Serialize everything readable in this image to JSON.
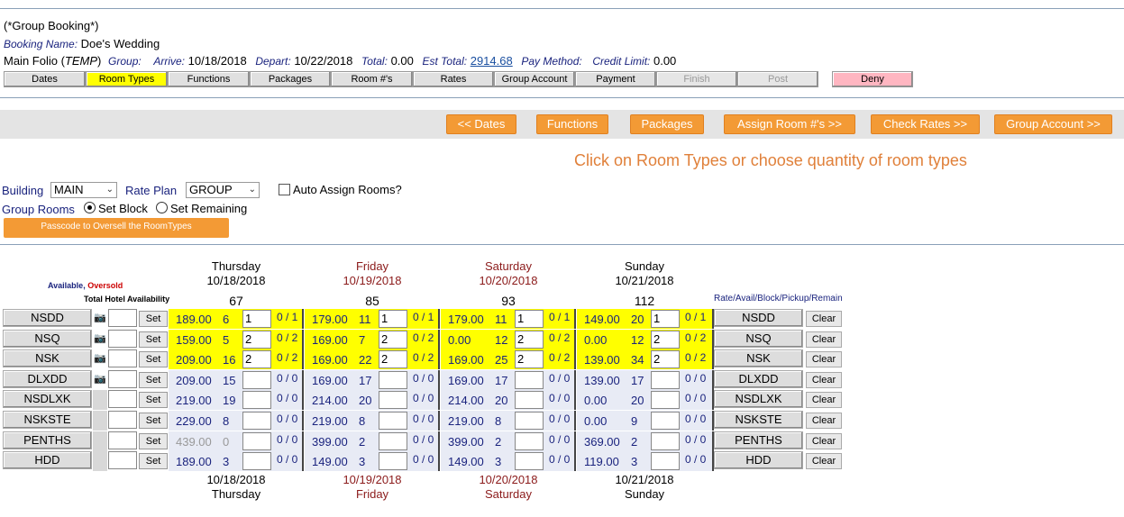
{
  "booking": {
    "group_flag": "(*Group Booking*)",
    "booking_name_label": "Booking Name:",
    "booking_name": "Doe's Wedding",
    "folio_prefix": "Main Folio (",
    "folio_temp": "TEMP",
    "folio_suffix": ")",
    "group_label": "Group:",
    "arrive_label": "Arrive:",
    "arrive": "10/18/2018",
    "depart_label": "Depart:",
    "depart": "10/22/2018",
    "total_label": "Total:",
    "total": "0.00",
    "est_total_label": "Est Total:",
    "est_total": "2914.68",
    "pay_method_label": "Pay Method:",
    "credit_limit_label": "Credit Limit:",
    "credit_limit": "0.00"
  },
  "tabs": [
    {
      "label": "Dates"
    },
    {
      "label": "Room Types"
    },
    {
      "label": "Functions"
    },
    {
      "label": "Packages"
    },
    {
      "label": "Room #'s"
    },
    {
      "label": "Rates"
    },
    {
      "label": "Group Account"
    },
    {
      "label": "Payment"
    },
    {
      "label": "Finish"
    },
    {
      "label": "Post"
    },
    {
      "label": "Deny"
    }
  ],
  "actions": {
    "dates": "<< Dates",
    "functions": "Functions",
    "packages": "Packages",
    "assign": "Assign Room #'s >>",
    "check_rates": "Check Rates >>",
    "group_account": "Group Account >>"
  },
  "message": "Click on Room Types or choose quantity of room types",
  "filters": {
    "building_label": "Building",
    "building_value": "MAIN",
    "rate_plan_label": "Rate Plan",
    "rate_plan_value": "GROUP",
    "auto_assign_label": "Auto Assign Rooms?",
    "group_rooms_label": "Group Rooms",
    "set_block_label": "Set Block",
    "set_remaining_label": "Set Remaining",
    "passcode_button": "Passcode to Oversell the RoomTypes"
  },
  "legend": {
    "available": "Available",
    "comma": ",",
    "oversold": "Oversold",
    "total_hotel": "Total Hotel Availability",
    "right_header": "Rate/Avail/Block/Pickup/Remain"
  },
  "days": [
    {
      "day": "Thursday",
      "date": "10/18/2018",
      "total": "67"
    },
    {
      "day": "Friday",
      "date": "10/19/2018",
      "total": "85"
    },
    {
      "day": "Saturday",
      "date": "10/20/2018",
      "total": "93"
    },
    {
      "day": "Sunday",
      "date": "10/21/2018",
      "total": "112"
    }
  ],
  "rows": [
    {
      "type": "NSDD",
      "cells": [
        {
          "rate": "189.00",
          "avail": "6",
          "qty": "1",
          "pr": "0 / 1"
        },
        {
          "rate": "179.00",
          "avail": "11",
          "qty": "1",
          "pr": "0 / 1"
        },
        {
          "rate": "179.00",
          "avail": "11",
          "qty": "1",
          "pr": "0 / 1"
        },
        {
          "rate": "149.00",
          "avail": "20",
          "qty": "1",
          "pr": "0 / 1"
        }
      ]
    },
    {
      "type": "NSQ",
      "cells": [
        {
          "rate": "159.00",
          "avail": "5",
          "qty": "2",
          "pr": "0 / 2"
        },
        {
          "rate": "169.00",
          "avail": "7",
          "qty": "2",
          "pr": "0 / 2"
        },
        {
          "rate": "0.00",
          "avail": "12",
          "qty": "2",
          "pr": "0 / 2"
        },
        {
          "rate": "0.00",
          "avail": "12",
          "qty": "2",
          "pr": "0 / 2"
        }
      ]
    },
    {
      "type": "NSK",
      "cells": [
        {
          "rate": "209.00",
          "avail": "16",
          "qty": "2",
          "pr": "0 / 2"
        },
        {
          "rate": "169.00",
          "avail": "22",
          "qty": "2",
          "pr": "0 / 2"
        },
        {
          "rate": "169.00",
          "avail": "25",
          "qty": "2",
          "pr": "0 / 2"
        },
        {
          "rate": "139.00",
          "avail": "34",
          "qty": "2",
          "pr": "0 / 2"
        }
      ]
    },
    {
      "type": "DLXDD",
      "cells": [
        {
          "rate": "209.00",
          "avail": "15",
          "qty": "",
          "pr": "0 / 0"
        },
        {
          "rate": "169.00",
          "avail": "17",
          "qty": "",
          "pr": "0 / 0"
        },
        {
          "rate": "169.00",
          "avail": "17",
          "qty": "",
          "pr": "0 / 0"
        },
        {
          "rate": "139.00",
          "avail": "17",
          "qty": "",
          "pr": "0 / 0"
        }
      ]
    },
    {
      "type": "NSDLXK",
      "cells": [
        {
          "rate": "219.00",
          "avail": "19",
          "qty": "",
          "pr": "0 / 0"
        },
        {
          "rate": "214.00",
          "avail": "20",
          "qty": "",
          "pr": "0 / 0"
        },
        {
          "rate": "214.00",
          "avail": "20",
          "qty": "",
          "pr": "0 / 0"
        },
        {
          "rate": "0.00",
          "avail": "20",
          "qty": "",
          "pr": "0 / 0"
        }
      ]
    },
    {
      "type": "NSKSTE",
      "cells": [
        {
          "rate": "229.00",
          "avail": "8",
          "qty": "",
          "pr": "0 / 0"
        },
        {
          "rate": "219.00",
          "avail": "8",
          "qty": "",
          "pr": "0 / 0"
        },
        {
          "rate": "219.00",
          "avail": "8",
          "qty": "",
          "pr": "0 / 0"
        },
        {
          "rate": "0.00",
          "avail": "9",
          "qty": "",
          "pr": "0 / 0"
        }
      ]
    },
    {
      "type": "PENTHS",
      "cells": [
        {
          "rate": "439.00",
          "avail": "0",
          "qty": "",
          "pr": "0 / 0"
        },
        {
          "rate": "399.00",
          "avail": "2",
          "qty": "",
          "pr": "0 / 0"
        },
        {
          "rate": "399.00",
          "avail": "2",
          "qty": "",
          "pr": "0 / 0"
        },
        {
          "rate": "369.00",
          "avail": "2",
          "qty": "",
          "pr": "0 / 0"
        }
      ]
    },
    {
      "type": "HDD",
      "cells": [
        {
          "rate": "189.00",
          "avail": "3",
          "qty": "",
          "pr": "0 / 0"
        },
        {
          "rate": "149.00",
          "avail": "3",
          "qty": "",
          "pr": "0 / 0"
        },
        {
          "rate": "149.00",
          "avail": "3",
          "qty": "",
          "pr": "0 / 0"
        },
        {
          "rate": "119.00",
          "avail": "3",
          "qty": "",
          "pr": "0 / 0"
        }
      ]
    }
  ],
  "set_label": "Set",
  "clear_label": "Clear"
}
